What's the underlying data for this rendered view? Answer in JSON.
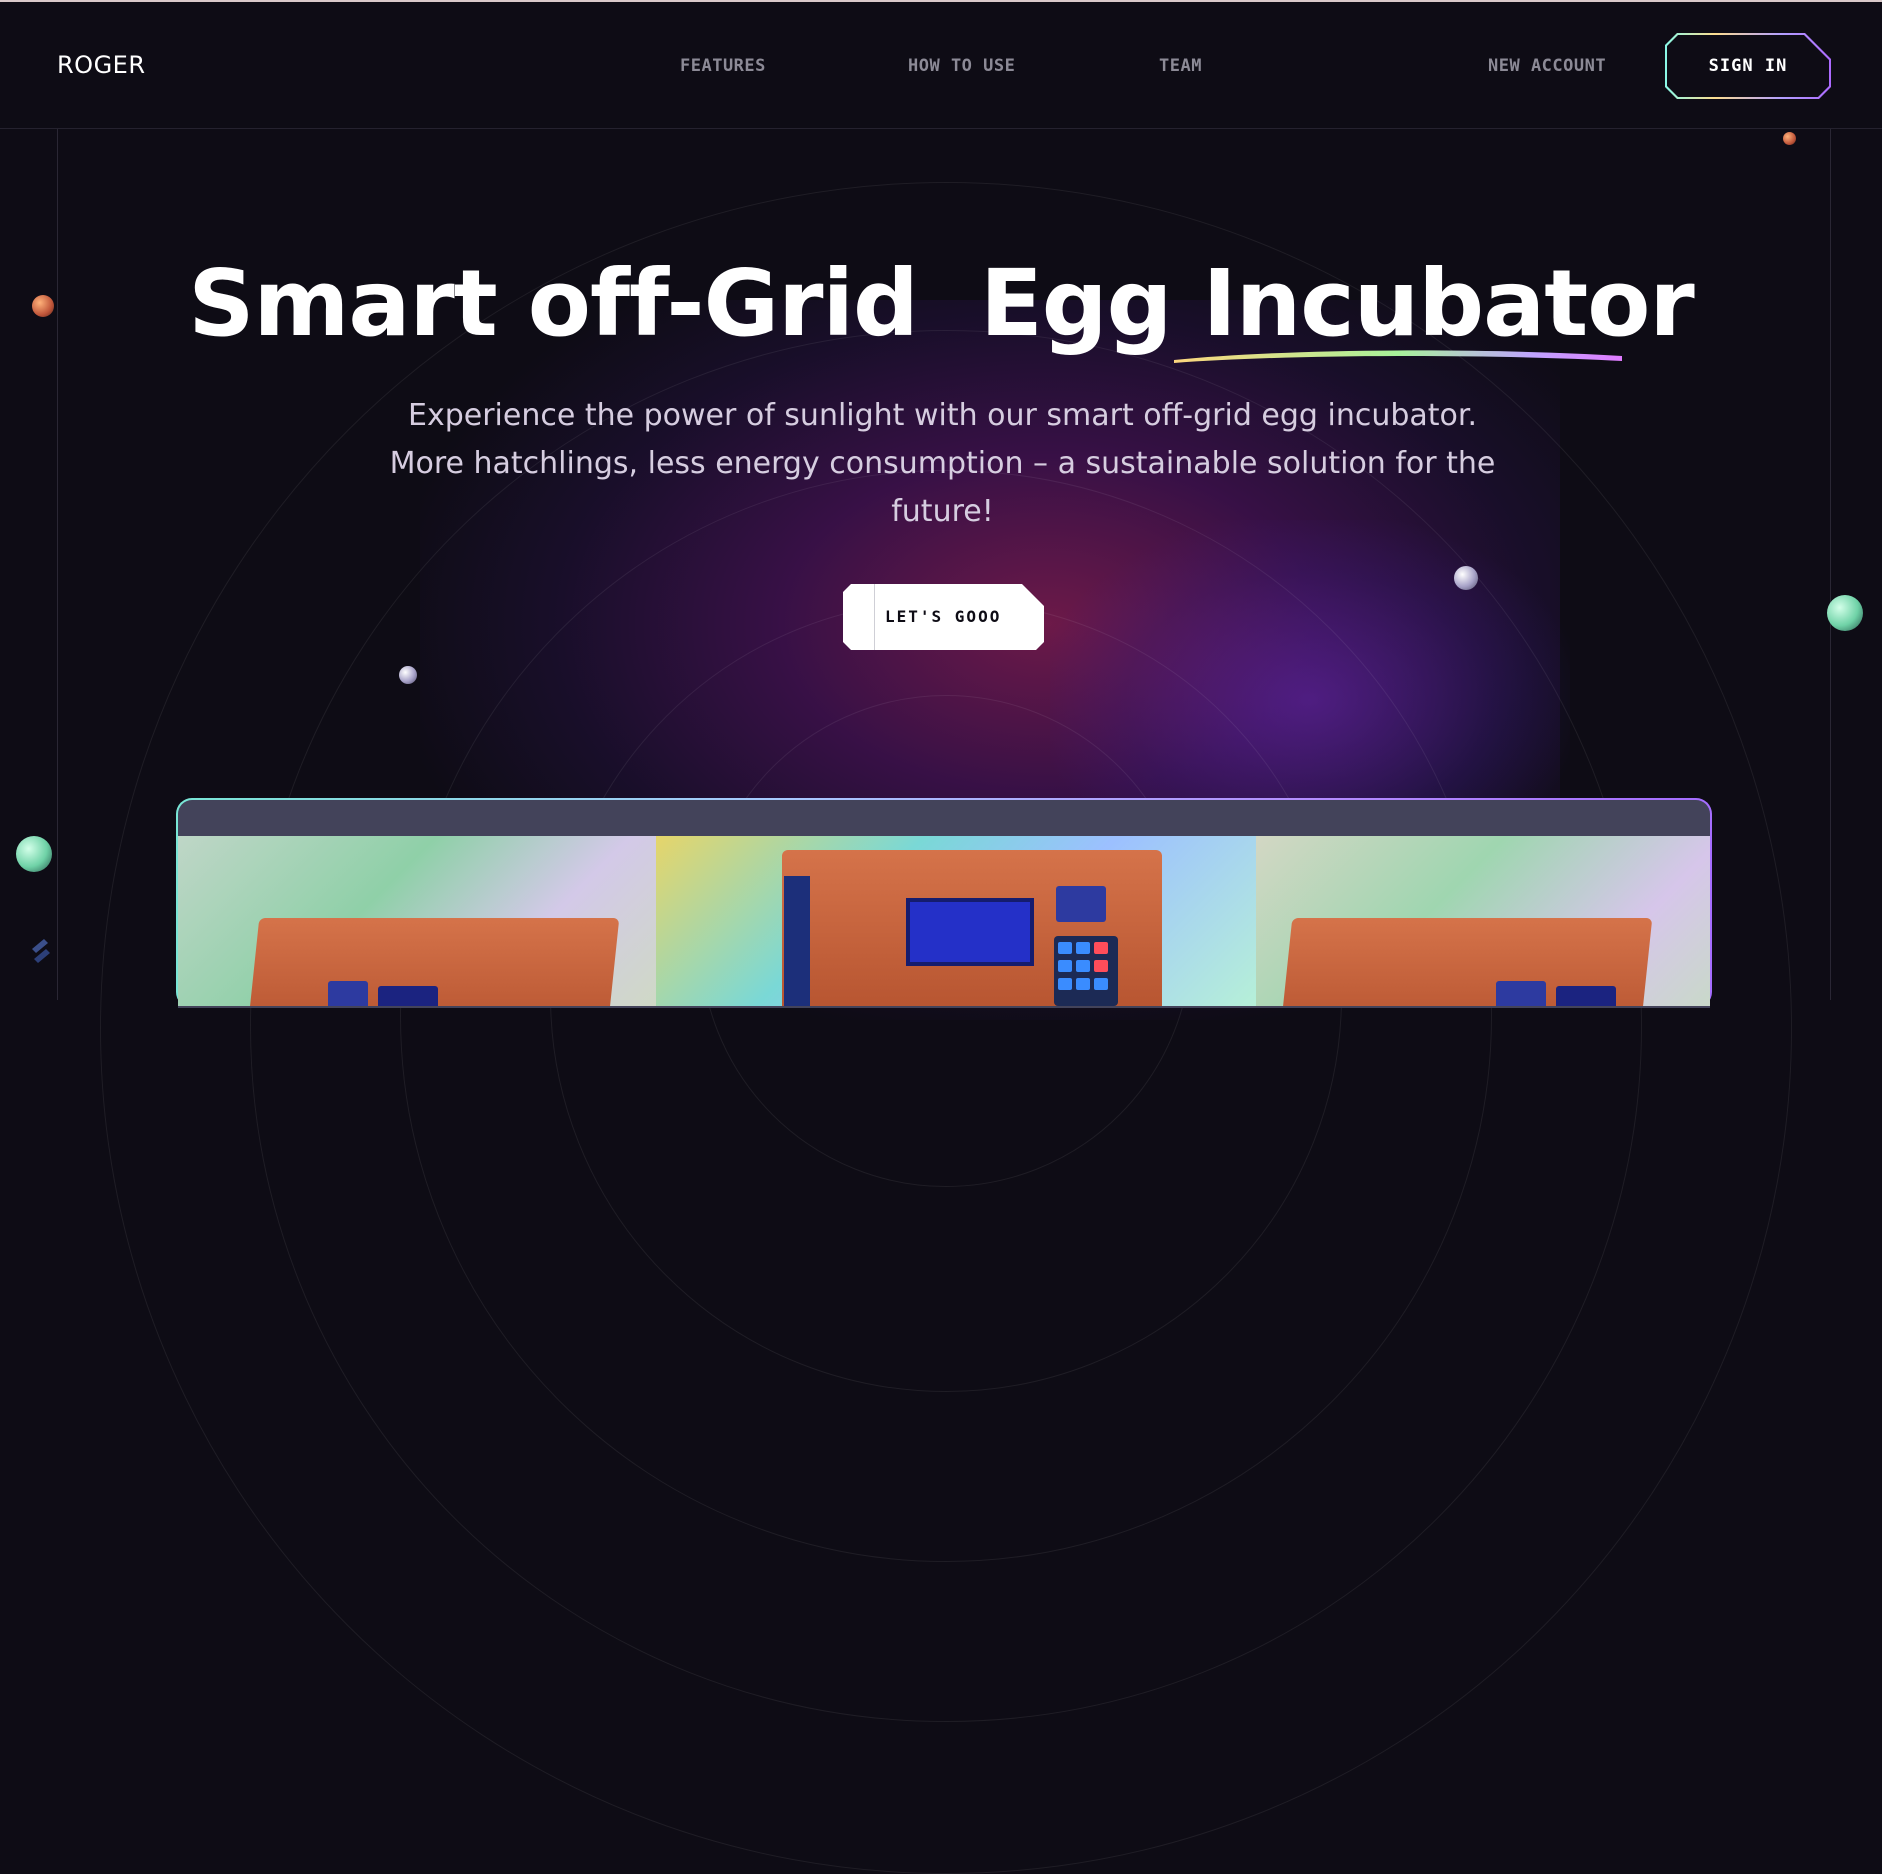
{
  "header": {
    "logo": "ROGER",
    "nav": [
      {
        "label": "FEATURES"
      },
      {
        "label": "HOW TO USE"
      },
      {
        "label": "TEAM"
      }
    ],
    "new_account": "NEW ACCOUNT",
    "sign_in": "SIGN IN"
  },
  "hero": {
    "title_part1": "Smart off-Grid  Egg ",
    "title_highlight": "Incubator",
    "subtitle": "Experience the power of sunlight with our smart off-grid egg incubator. More hatchlings, less energy consumption – a sustainable solution for the future!",
    "cta": "LET'S GOOO"
  },
  "colors": {
    "background": "#0e0c15",
    "accent_teal": "#89f9e8",
    "accent_purple": "#ac6aff",
    "accent_orange": "#d5734a"
  },
  "icons": [
    "brainwave-logo-icon"
  ]
}
